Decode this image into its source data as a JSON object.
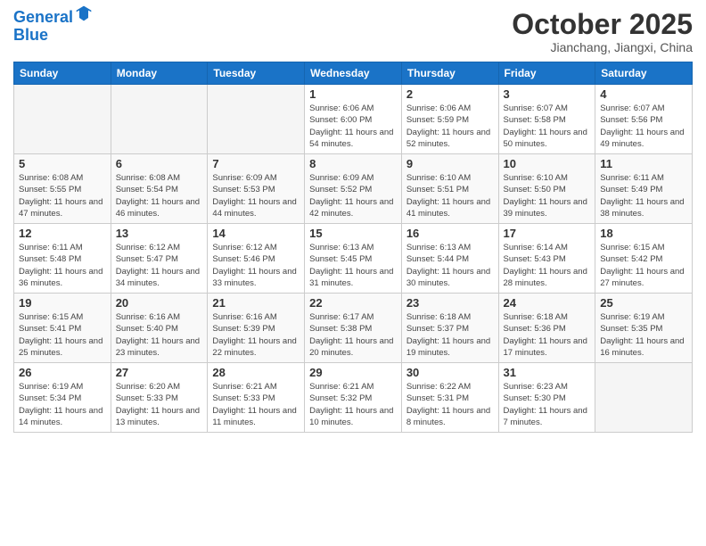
{
  "header": {
    "logo_line1": "General",
    "logo_line2": "Blue",
    "title": "October 2025",
    "subtitle": "Jianchang, Jiangxi, China"
  },
  "weekdays": [
    "Sunday",
    "Monday",
    "Tuesday",
    "Wednesday",
    "Thursday",
    "Friday",
    "Saturday"
  ],
  "weeks": [
    [
      {
        "day": "",
        "info": ""
      },
      {
        "day": "",
        "info": ""
      },
      {
        "day": "",
        "info": ""
      },
      {
        "day": "1",
        "info": "Sunrise: 6:06 AM\nSunset: 6:00 PM\nDaylight: 11 hours\nand 54 minutes."
      },
      {
        "day": "2",
        "info": "Sunrise: 6:06 AM\nSunset: 5:59 PM\nDaylight: 11 hours\nand 52 minutes."
      },
      {
        "day": "3",
        "info": "Sunrise: 6:07 AM\nSunset: 5:58 PM\nDaylight: 11 hours\nand 50 minutes."
      },
      {
        "day": "4",
        "info": "Sunrise: 6:07 AM\nSunset: 5:56 PM\nDaylight: 11 hours\nand 49 minutes."
      }
    ],
    [
      {
        "day": "5",
        "info": "Sunrise: 6:08 AM\nSunset: 5:55 PM\nDaylight: 11 hours\nand 47 minutes."
      },
      {
        "day": "6",
        "info": "Sunrise: 6:08 AM\nSunset: 5:54 PM\nDaylight: 11 hours\nand 46 minutes."
      },
      {
        "day": "7",
        "info": "Sunrise: 6:09 AM\nSunset: 5:53 PM\nDaylight: 11 hours\nand 44 minutes."
      },
      {
        "day": "8",
        "info": "Sunrise: 6:09 AM\nSunset: 5:52 PM\nDaylight: 11 hours\nand 42 minutes."
      },
      {
        "day": "9",
        "info": "Sunrise: 6:10 AM\nSunset: 5:51 PM\nDaylight: 11 hours\nand 41 minutes."
      },
      {
        "day": "10",
        "info": "Sunrise: 6:10 AM\nSunset: 5:50 PM\nDaylight: 11 hours\nand 39 minutes."
      },
      {
        "day": "11",
        "info": "Sunrise: 6:11 AM\nSunset: 5:49 PM\nDaylight: 11 hours\nand 38 minutes."
      }
    ],
    [
      {
        "day": "12",
        "info": "Sunrise: 6:11 AM\nSunset: 5:48 PM\nDaylight: 11 hours\nand 36 minutes."
      },
      {
        "day": "13",
        "info": "Sunrise: 6:12 AM\nSunset: 5:47 PM\nDaylight: 11 hours\nand 34 minutes."
      },
      {
        "day": "14",
        "info": "Sunrise: 6:12 AM\nSunset: 5:46 PM\nDaylight: 11 hours\nand 33 minutes."
      },
      {
        "day": "15",
        "info": "Sunrise: 6:13 AM\nSunset: 5:45 PM\nDaylight: 11 hours\nand 31 minutes."
      },
      {
        "day": "16",
        "info": "Sunrise: 6:13 AM\nSunset: 5:44 PM\nDaylight: 11 hours\nand 30 minutes."
      },
      {
        "day": "17",
        "info": "Sunrise: 6:14 AM\nSunset: 5:43 PM\nDaylight: 11 hours\nand 28 minutes."
      },
      {
        "day": "18",
        "info": "Sunrise: 6:15 AM\nSunset: 5:42 PM\nDaylight: 11 hours\nand 27 minutes."
      }
    ],
    [
      {
        "day": "19",
        "info": "Sunrise: 6:15 AM\nSunset: 5:41 PM\nDaylight: 11 hours\nand 25 minutes."
      },
      {
        "day": "20",
        "info": "Sunrise: 6:16 AM\nSunset: 5:40 PM\nDaylight: 11 hours\nand 23 minutes."
      },
      {
        "day": "21",
        "info": "Sunrise: 6:16 AM\nSunset: 5:39 PM\nDaylight: 11 hours\nand 22 minutes."
      },
      {
        "day": "22",
        "info": "Sunrise: 6:17 AM\nSunset: 5:38 PM\nDaylight: 11 hours\nand 20 minutes."
      },
      {
        "day": "23",
        "info": "Sunrise: 6:18 AM\nSunset: 5:37 PM\nDaylight: 11 hours\nand 19 minutes."
      },
      {
        "day": "24",
        "info": "Sunrise: 6:18 AM\nSunset: 5:36 PM\nDaylight: 11 hours\nand 17 minutes."
      },
      {
        "day": "25",
        "info": "Sunrise: 6:19 AM\nSunset: 5:35 PM\nDaylight: 11 hours\nand 16 minutes."
      }
    ],
    [
      {
        "day": "26",
        "info": "Sunrise: 6:19 AM\nSunset: 5:34 PM\nDaylight: 11 hours\nand 14 minutes."
      },
      {
        "day": "27",
        "info": "Sunrise: 6:20 AM\nSunset: 5:33 PM\nDaylight: 11 hours\nand 13 minutes."
      },
      {
        "day": "28",
        "info": "Sunrise: 6:21 AM\nSunset: 5:33 PM\nDaylight: 11 hours\nand 11 minutes."
      },
      {
        "day": "29",
        "info": "Sunrise: 6:21 AM\nSunset: 5:32 PM\nDaylight: 11 hours\nand 10 minutes."
      },
      {
        "day": "30",
        "info": "Sunrise: 6:22 AM\nSunset: 5:31 PM\nDaylight: 11 hours\nand 8 minutes."
      },
      {
        "day": "31",
        "info": "Sunrise: 6:23 AM\nSunset: 5:30 PM\nDaylight: 11 hours\nand 7 minutes."
      },
      {
        "day": "",
        "info": ""
      }
    ]
  ]
}
